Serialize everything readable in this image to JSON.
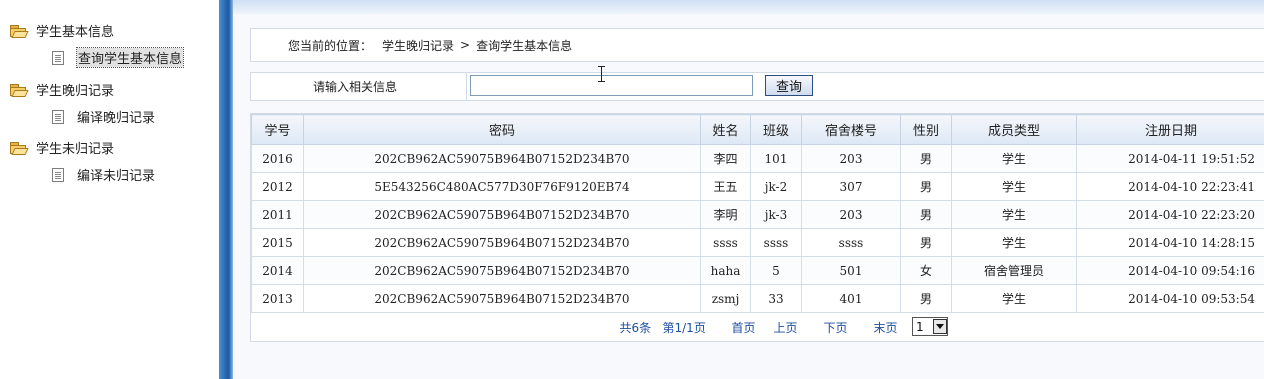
{
  "sidebar": {
    "groups": [
      {
        "label": "学生基本信息",
        "children": [
          {
            "label": "查询学生基本信息",
            "selected": true
          }
        ]
      },
      {
        "label": "学生晚归记录",
        "children": [
          {
            "label": "编译晚归记录",
            "selected": false
          }
        ]
      },
      {
        "label": "学生未归记录",
        "children": [
          {
            "label": "编译未归记录",
            "selected": false
          }
        ]
      }
    ]
  },
  "breadcrumb": {
    "prefix": "您当前的位置：",
    "level1": "学生晚归记录",
    "separator": ">",
    "level2": "查询学生基本信息"
  },
  "search": {
    "label": "请输入相关信息",
    "value": "",
    "button_label": "查询"
  },
  "table": {
    "headers": [
      "学号",
      "密码",
      "姓名",
      "班级",
      "宿舍楼号",
      "性别",
      "成员类型",
      "注册日期"
    ],
    "rows": [
      [
        "2016",
        "202CB962AC59075B964B07152D234B70",
        "李四",
        "101",
        "203",
        "男",
        "学生",
        "2014-04-11 19:51:52"
      ],
      [
        "2012",
        "5E543256C480AC577D30F76F9120EB74",
        "王五",
        "jk-2",
        "307",
        "男",
        "学生",
        "2014-04-10 22:23:41"
      ],
      [
        "2011",
        "202CB962AC59075B964B07152D234B70",
        "李明",
        "jk-3",
        "203",
        "男",
        "学生",
        "2014-04-10 22:23:20"
      ],
      [
        "2015",
        "202CB962AC59075B964B07152D234B70",
        "ssss",
        "ssss",
        "ssss",
        "男",
        "学生",
        "2014-04-10 14:28:15"
      ],
      [
        "2014",
        "202CB962AC59075B964B07152D234B70",
        "haha",
        "5",
        "501",
        "女",
        "宿舍管理员",
        "2014-04-10 09:54:16"
      ],
      [
        "2013",
        "202CB962AC59075B964B07152D234B70",
        "zsmj",
        "33",
        "401",
        "男",
        "学生",
        "2014-04-10 09:53:54"
      ]
    ]
  },
  "pager": {
    "total": "共6条",
    "page_info": "第1/1页",
    "first": "首页",
    "prev": "上页",
    "next": "下页",
    "last": "末页",
    "page_select_value": "1"
  },
  "colors": {
    "splitter": "#2c6eb8",
    "link": "#1f4fa0",
    "header_bg": "#dde8f5"
  },
  "icons": {
    "group": "folder-open-icon",
    "child": "document-icon",
    "cursor": "text-cursor-icon"
  }
}
